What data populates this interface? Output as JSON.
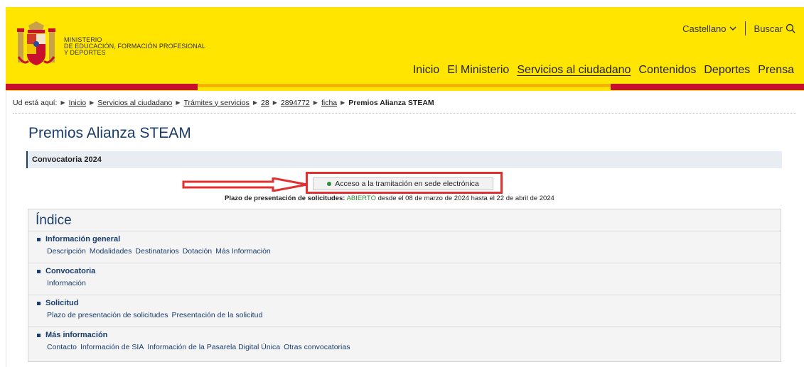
{
  "header": {
    "ministry_lines": [
      "MINISTERIO",
      "DE EDUCACIÓN, FORMACIÓN PROFESIONAL",
      "Y DEPORTES"
    ],
    "language": "Castellano",
    "search_label": "Buscar",
    "nav": [
      {
        "label": "Inicio",
        "active": false
      },
      {
        "label": "El Ministerio",
        "active": false
      },
      {
        "label": "Servicios al ciudadano",
        "active": true
      },
      {
        "label": "Contenidos",
        "active": false
      },
      {
        "label": "Deportes",
        "active": false
      },
      {
        "label": "Prensa",
        "active": false
      }
    ],
    "colors": {
      "yellow": "#ffe500",
      "red": "#c8102e",
      "gold": "#f2b400"
    }
  },
  "breadcrumb": {
    "prefix": "Ud está aquí:",
    "items": [
      "Inicio",
      "Servicios al ciudadano",
      "Trámites y servicios",
      "28",
      "2894772",
      "ficha"
    ],
    "current": "Premios Alianza STEAM"
  },
  "page": {
    "title": "Premios Alianza STEAM",
    "convocatoria": "Convocatoria 2024",
    "access_button": "Acceso a la tramitación en sede electrónica",
    "plazo_label": "Plazo de presentación de solicitudes:",
    "plazo_status": "ABIERTO",
    "plazo_rest": "desde el 08 de marzo de 2024 hasta el 22 de abril de 2024"
  },
  "indice": {
    "title": "Índice",
    "sections": [
      {
        "title": "Información general",
        "links": [
          "Descripción",
          "Modalidades",
          "Destinatarios",
          "Dotación",
          "Más Información"
        ]
      },
      {
        "title": "Convocatoria",
        "links": [
          "Información"
        ]
      },
      {
        "title": "Solicitud",
        "links": [
          "Plazo de presentación de solicitudes",
          "Presentación de la solicitud"
        ]
      },
      {
        "title": "Más información",
        "links": [
          "Contacto",
          "Información de SIA",
          "Información de la Pasarela Digital Única",
          "Otras convocatorias"
        ]
      }
    ]
  }
}
